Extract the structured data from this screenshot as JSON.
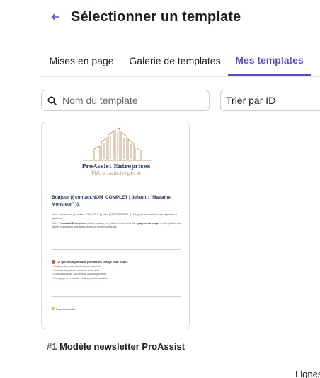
{
  "header": {
    "back_label": "←",
    "title": "Sélectionner un template"
  },
  "tabs": [
    {
      "label": "Mises en page",
      "active": false
    },
    {
      "label": "Galerie de templates",
      "active": false
    },
    {
      "label": "Mes templates",
      "active": true
    }
  ],
  "search": {
    "placeholder": "Nom du template",
    "value": ""
  },
  "sort": {
    "selected": "Trier par ID"
  },
  "templates": [
    {
      "id_label": "#1",
      "name": "Modèle newsletter ProAssist",
      "preview": {
        "brand_name": "ProAssist Entreprises",
        "brand_tagline": "Votre conciergerie",
        "greeting": "Bonjour {{ contact.NOM_COMPLET | default : \"Madame, Monsieur\" }},",
        "paragraph_1": "Nous savons que {{ contact.JOB_TITLE }} chez {{ ENTREPRISE }} doit gérer de nombreuses urgences au quotidien.",
        "paragraph_2_start": "Chez ",
        "paragraph_2_brand": "ProAssist Entreprises",
        "paragraph_2_mid": ", notre mission est justement de vous faire ",
        "paragraph_2_bold": "gagner du temps",
        "paragraph_2_end": " en simplifiant vos tâches logistiques, administratives ou événementielles.",
        "services_title": "Ce que nous pouvons prendre en charge pour vous :",
        "services": [
          "• Gestion de vos véhicules professionnels",
          "• Courses express et services à la carte",
          "• Coordination de vos rendez-vous importants",
          "• Nettoyage & retour de leasing sans contrainte"
        ],
        "footer_hint": "Pour demander..."
      }
    }
  ],
  "footer": {
    "lines_label": "Lignes"
  },
  "colors": {
    "accent": "#5b4cc4",
    "brand_navy": "#2c3e6b",
    "brand_gold": "#b5875a"
  }
}
